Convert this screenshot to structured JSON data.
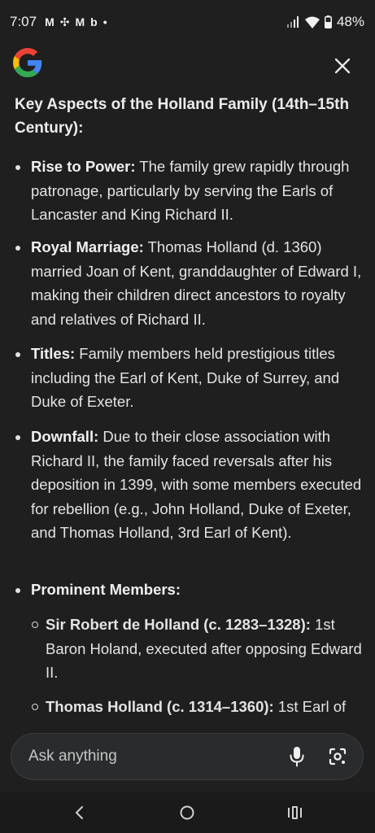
{
  "status": {
    "time": "7:07",
    "notification_icons": [
      "M",
      "✣",
      "M",
      "b",
      "•"
    ],
    "battery": "48%"
  },
  "heading": "Key Aspects of the Holland Family (14th–15th Century):",
  "items": [
    {
      "label": "Rise to Power:",
      "text": " The family grew rapidly through patronage, particularly by serving the Earls of Lancaster and King Richard II."
    },
    {
      "label": "Royal Marriage:",
      "text": " Thomas Holland (d. 1360) married Joan of Kent, granddaughter of Edward I, making their children direct ancestors to royalty and relatives of Richard II."
    },
    {
      "label": "Titles:",
      "text": " Family members held prestigious titles including the Earl of Kent, Duke of Surrey, and Duke of Exeter."
    },
    {
      "label": "Downfall:",
      "text": " Due to their close association with Richard II, the family faced reversals after his deposition in 1399, with some members executed for rebellion (e.g., John Holland, Duke of Exeter, and Thomas Holland, 3rd Earl of Kent)."
    },
    {
      "label": "Prominent Members:",
      "text": ""
    }
  ],
  "subitems": [
    {
      "label": "Sir Robert de Holland (c. 1283–1328):",
      "text": " 1st Baron Holand, executed after opposing Edward II."
    },
    {
      "label": "Thomas Holland (c. 1314–1360):",
      "text": " 1st Earl of"
    }
  ],
  "search": {
    "placeholder": "Ask anything"
  },
  "icons": {
    "logo": "google-logo",
    "close": "close-icon",
    "mic": "mic-icon",
    "lens": "lens-icon",
    "back": "back-icon",
    "home": "home-icon",
    "recents": "recents-icon"
  },
  "colors": {
    "background": "#1f1f1f",
    "text": "#e3e3e3",
    "search_bg": "#2a2b2d"
  }
}
